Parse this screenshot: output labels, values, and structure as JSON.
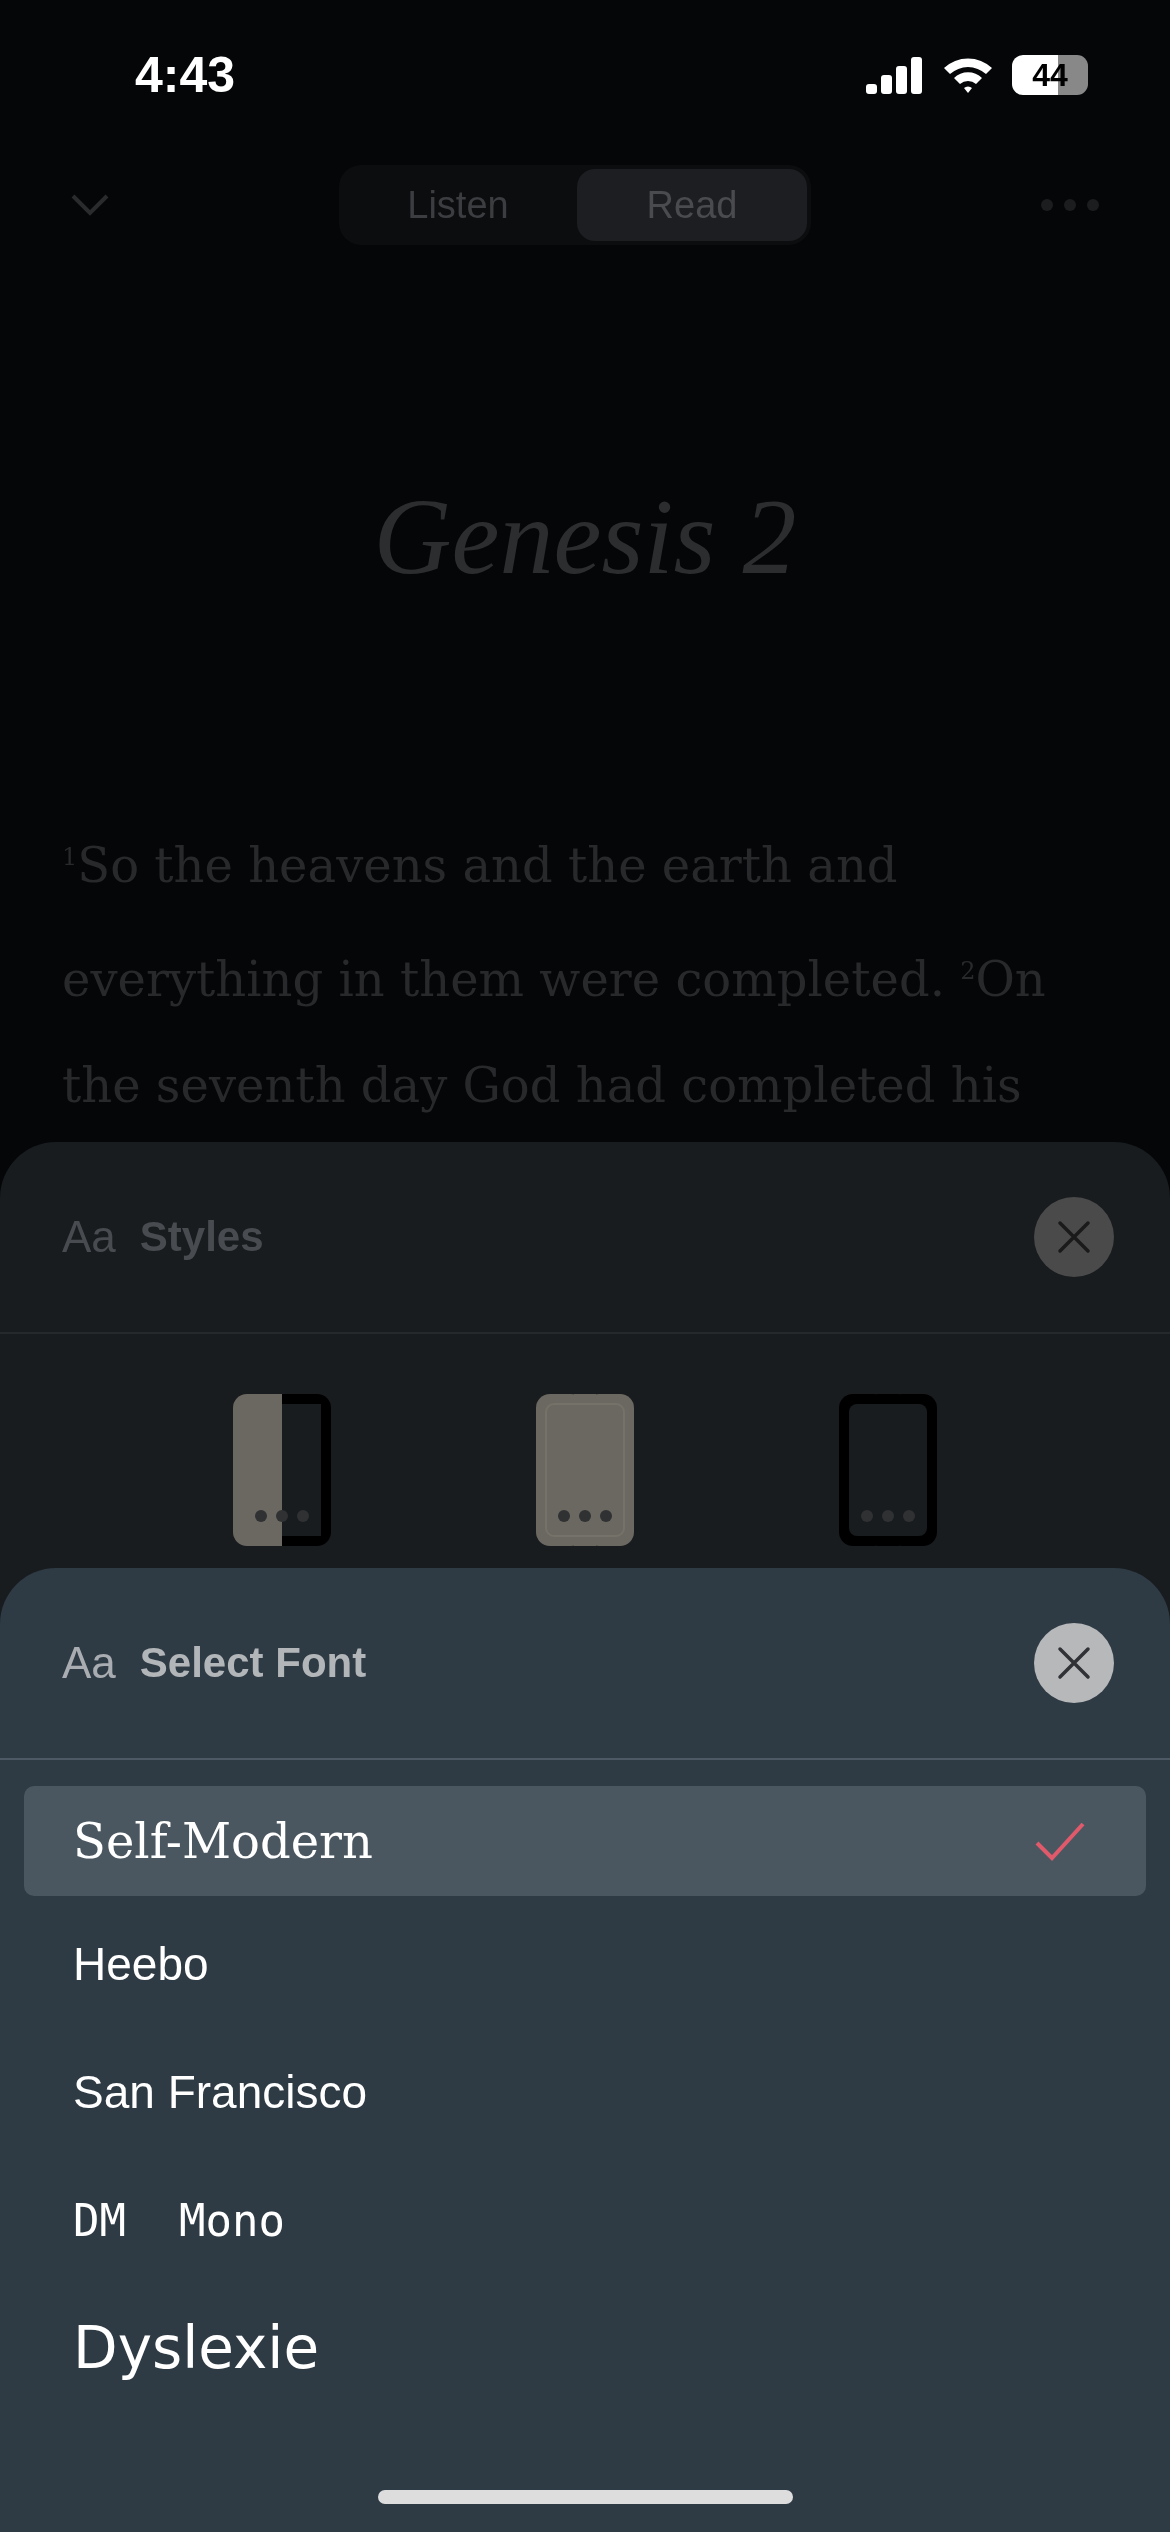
{
  "status_bar": {
    "time": "4:43",
    "battery": "44"
  },
  "nav": {
    "tabs": [
      {
        "label": "Listen",
        "selected": false
      },
      {
        "label": "Read",
        "selected": true
      }
    ]
  },
  "chapter": {
    "title": "Genesis 2",
    "text": "$^{1}$So the heavens and the earth and everything in them were completed. $^{2}$On the seventh day God had completed his"
  },
  "styles_sheet": {
    "icon_text": "Aa",
    "title": "Styles",
    "themes": [
      {
        "kind": "split"
      },
      {
        "kind": "light"
      },
      {
        "kind": "dark"
      }
    ]
  },
  "font_sheet": {
    "icon_text": "Aa",
    "title": "Select Font",
    "fonts": [
      {
        "name": "Self-Modern",
        "kind": "serif",
        "selected": true
      },
      {
        "name": "Heebo",
        "kind": "sans",
        "selected": false
      },
      {
        "name": "San Francisco",
        "kind": "sans",
        "selected": false
      },
      {
        "name": "DM  Mono",
        "kind": "mono",
        "selected": false
      },
      {
        "name": "Dyslexie",
        "kind": "dyslexic",
        "selected": false
      }
    ]
  }
}
